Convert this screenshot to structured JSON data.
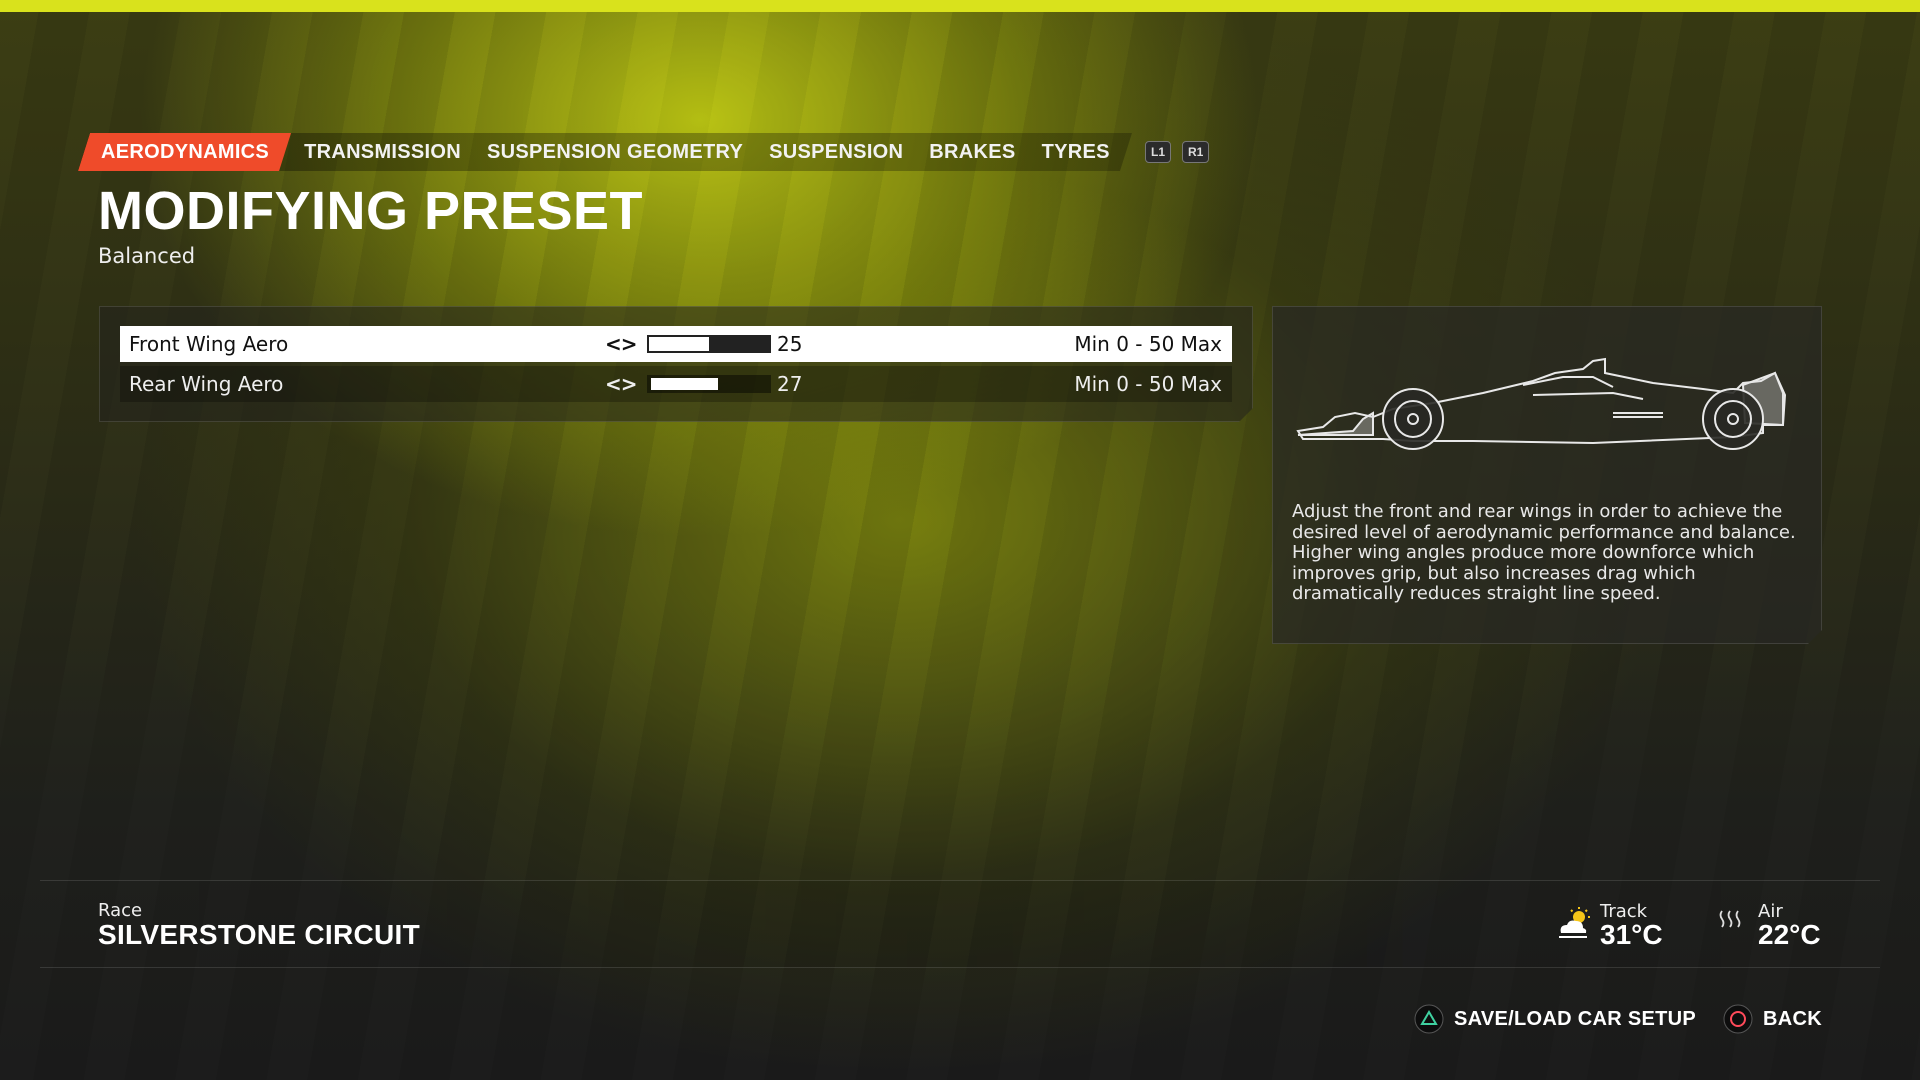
{
  "tabs": [
    {
      "label": "AERODYNAMICS",
      "active": true
    },
    {
      "label": "TRANSMISSION",
      "active": false
    },
    {
      "label": "SUSPENSION GEOMETRY",
      "active": false
    },
    {
      "label": "SUSPENSION",
      "active": false
    },
    {
      "label": "BRAKES",
      "active": false
    },
    {
      "label": "TYRES",
      "active": false
    }
  ],
  "bumpers": {
    "left": "L1",
    "right": "R1"
  },
  "header": {
    "title": "MODIFYING PRESET",
    "subtitle": "Balanced"
  },
  "settings": [
    {
      "label": "Front Wing Aero",
      "value": "25",
      "min": 0,
      "max": 50,
      "range": "Min 0 - 50 Max",
      "selected": true
    },
    {
      "label": "Rear Wing Aero",
      "value": "27",
      "min": 0,
      "max": 50,
      "range": "Min 0 - 50 Max",
      "selected": false
    }
  ],
  "info": {
    "line1": "Adjust the front and rear wings in order to achieve the desired level of aerodynamic performance and balance.",
    "line2": "Higher wing angles produce more downforce which improves grip, but also increases drag which dramatically reduces straight line speed."
  },
  "session": {
    "type": "Race",
    "circuit": "SILVERSTONE CIRCUIT"
  },
  "weather": {
    "track_label": "Track",
    "track_temp": "31°C",
    "track_icon": "partly-sunny-icon",
    "air_label": "Air",
    "air_temp": "22°C",
    "air_icon": "heat-waves-icon"
  },
  "footer": {
    "save_load": "SAVE/LOAD CAR SETUP",
    "back": "BACK"
  },
  "colors": {
    "accent": "#ef4b2a",
    "top_line": "#d9e21c",
    "triangle": "#3fd0a0",
    "circle": "#ff4a5a"
  }
}
